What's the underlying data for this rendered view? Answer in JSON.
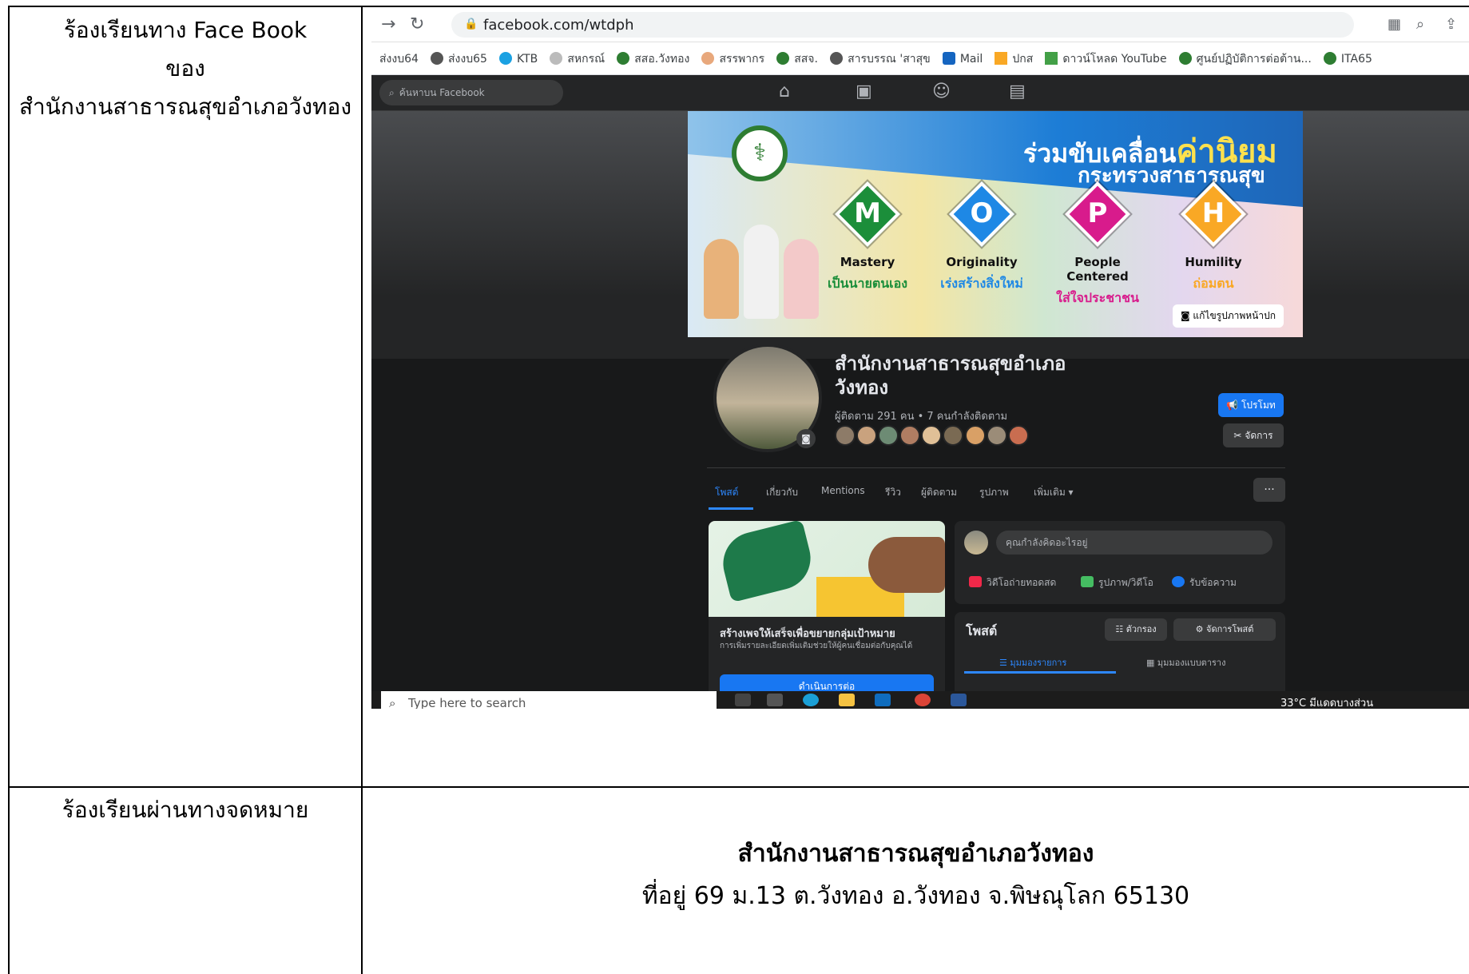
{
  "labels": {
    "facebook_line1": "ร้องเรียนทาง Face Book",
    "facebook_line2": "ของ",
    "facebook_line3": "สำนักงานสาธารณสุขอำเภอวังทอง",
    "mail": "ร้องเรียนผ่านทางจดหมาย"
  },
  "browser": {
    "url": "facebook.com/wtdph",
    "bookmarks": [
      "ส่งงบ64",
      "ส่งงบ65",
      "KTB",
      "สหกรณ์",
      "สสอ.วังทอง",
      "สรรพากร",
      "สสจ.",
      "สารบรรณ 'สาสุข",
      "Mail",
      "ปกส",
      "ดาวน์โหลด YouTube",
      "ศูนย์ปฏิบัติการต่อต้าน...",
      "ITA65"
    ]
  },
  "facebook": {
    "search_placeholder": "ค้นหาบน Facebook",
    "cover": {
      "headline_small": "ร่วมขับเคลื่อน",
      "headline_big": "ค่านิยม",
      "headline_line2": "กระทรวงสาธารณสุข",
      "values": [
        {
          "letter": "M",
          "name": "Mastery",
          "thai": "เป็นนายตนเอง",
          "color": "#1b8e3a"
        },
        {
          "letter": "O",
          "name": "Originality",
          "thai": "เร่งสร้างสิ่งใหม่",
          "color": "#1e88e5"
        },
        {
          "letter": "P",
          "name": "People Centered",
          "thai": "ใส่ใจประชาชน",
          "color": "#d81b8c"
        },
        {
          "letter": "H",
          "name": "Humility",
          "thai": "ถ่อมตน",
          "color": "#f9a825"
        }
      ],
      "edit_button": "แก้ไขรูปภาพหน้าปก"
    },
    "page_name": "สำนักงานสาธารณสุขอำเภอ วังทอง",
    "followers": "ผู้ติดตาม 291 คน • 7 คนกำลังติดตาม",
    "promote_button": "โปรโมท",
    "manage_button": "จัดการ",
    "tabs": [
      "โพสต์",
      "เกี่ยวกับ",
      "Mentions",
      "รีวิว",
      "ผู้ติดตาม",
      "รูปภาพ",
      "เพิ่มเติม ▾"
    ],
    "more_button": "···",
    "promo": {
      "title": "สร้างเพจให้เสร็จเพื่อขยายกลุ่มเป้าหมาย",
      "subtitle": "การเพิ่มรายละเอียดเพิ่มเติมช่วยให้ผู้คนเชื่อมต่อกับคุณได้",
      "button": "ดำเนินการต่อ"
    },
    "composer": {
      "placeholder": "คุณกำลังคิดอะไรอยู่",
      "actions": [
        "วิดีโอถ่ายทอดสด",
        "รูปภาพ/วิดีโอ",
        "รับข้อความ"
      ]
    },
    "posts": {
      "title": "โพสต์",
      "filter_button": "ตัวกรอง",
      "manage_posts_button": "จัดการโพสต์",
      "view_list": "มุมมองรายการ",
      "view_grid": "มุมมองแบบตาราง"
    }
  },
  "taskbar": {
    "search_placeholder": "Type here to search",
    "status": "33°C มีแดดบางส่วน"
  },
  "address": {
    "org_name": "สำนักงานสาธารณสุขอำเภอวังทอง",
    "line": "ที่อยู่ 69 ม.13 ต.วังทอง  อ.วังทอง จ.พิษณุโลก 65130"
  }
}
